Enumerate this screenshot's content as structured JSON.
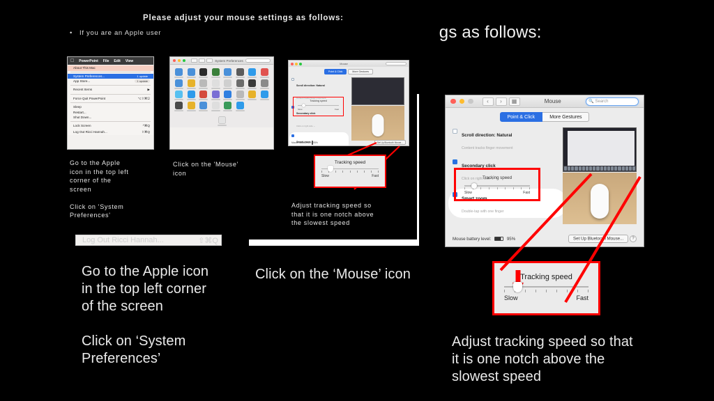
{
  "slide": {
    "title_small": "Please adjust your mouse settings as follows:",
    "bullet_small": "If you are an Apple user",
    "title_large_full": "Please adjust your mouse settings as follows:",
    "title_large_visible": "gs as follows:",
    "background_color": "#000000",
    "accent_color": "#ff0000",
    "text_color": "#eaeaea"
  },
  "steps": [
    {
      "id": "step-apple-menu",
      "caption_small": "Go to the Apple\nicon in the top left\ncorner of the\nscreen\n\nClick on 'System\nPreferences'",
      "caption_large": "Go to the Apple icon\nin the top left corner\nof the screen\n\nClick on ‘System\nPreferences’"
    },
    {
      "id": "step-mouse-icon",
      "caption_small": "Click on the 'Mouse'\nicon",
      "caption_large": "Click on the ‘Mouse’ icon"
    },
    {
      "id": "step-tracking-speed",
      "caption_small": "Adjust tracking speed so\nthat it is one notch above\nthe slowest speed",
      "caption_large": "Adjust tracking speed so that\nit is one notch above the\nslowest speed"
    }
  ],
  "apple_menu": {
    "menubar": {
      "apple_glyph": "",
      "app": "PowerPoint",
      "items": [
        "File",
        "Edit",
        "View"
      ]
    },
    "items": [
      {
        "label": "About This Mac",
        "badge": "",
        "shortcut": "",
        "style": "peach"
      },
      {
        "label": "System Preferences...",
        "badge": "1 update",
        "shortcut": "",
        "style": "selected"
      },
      {
        "label": "App Store...",
        "badge": "1 update",
        "shortcut": "",
        "style": "normal"
      },
      {
        "label": "Recent Items",
        "badge": "",
        "shortcut": "▶",
        "style": "normal"
      },
      {
        "label": "Force Quit PowerPoint",
        "badge": "",
        "shortcut": "⌥⇧⌘⎋",
        "style": "normal"
      },
      {
        "label": "Sleep",
        "badge": "",
        "shortcut": "",
        "style": "normal"
      },
      {
        "label": "Restart...",
        "badge": "",
        "shortcut": "",
        "style": "normal"
      },
      {
        "label": "Shut Down...",
        "badge": "",
        "shortcut": "",
        "style": "normal"
      },
      {
        "label": "Lock Screen",
        "badge": "",
        "shortcut": "^⌘Q",
        "style": "normal"
      },
      {
        "label": "Log Out Ricci Hannah...",
        "badge": "",
        "shortcut": "⇧⌘Q",
        "style": "normal"
      }
    ]
  },
  "system_preferences": {
    "window_title": "System Preferences",
    "search_placeholder": "Search",
    "icon_colors": [
      "#4a90d9",
      "#4a90d9",
      "#2b2b2b",
      "#3a7f3a",
      "#4a90d9",
      "#5b5b5b",
      "#2f9bea",
      "#e0534f",
      "#4a90d9",
      "#e7b22a",
      "#b9b9b9",
      "#dedede",
      "#cfcfcf",
      "#6b6b6b",
      "#3a3a3a",
      "#8a8a8a",
      "#57c0f0",
      "#2f9bea",
      "#d44a3c",
      "#7a6fd4",
      "#2f7fe0",
      "#b9b9b9",
      "#e7b22a",
      "#2f9bea",
      "#4a4a4a",
      "#e7b22a",
      "#4a90d9",
      "#dedede",
      "#3a9a5a",
      "#2f9bea"
    ]
  },
  "mouse_pane": {
    "window_title": "Mouse",
    "search_placeholder": "Search",
    "search_icon": "search-icon",
    "tabs": [
      {
        "label": "Point & Click",
        "selected": true
      },
      {
        "label": "More Gestures",
        "selected": false
      }
    ],
    "options": [
      {
        "title": "Scroll direction: Natural",
        "subtitle": "Content tracks finger movement",
        "checked": false,
        "highlighted": false
      },
      {
        "title": "Secondary click",
        "subtitle": "Click on right side ⌄",
        "checked": true,
        "highlighted": false
      },
      {
        "title": "Smart zoom",
        "subtitle": "Double-tap with one finger",
        "checked": true,
        "highlighted": true
      }
    ],
    "tracking": {
      "label": "Tracking speed",
      "min_label": "Slow",
      "max_label": "Fast",
      "notches": 9,
      "value_percent": 11
    },
    "battery_label": "Mouse battery level:",
    "battery_value": "95%",
    "setup_button": "Set Up Bluetooth Mouse...",
    "help_button": "?"
  }
}
